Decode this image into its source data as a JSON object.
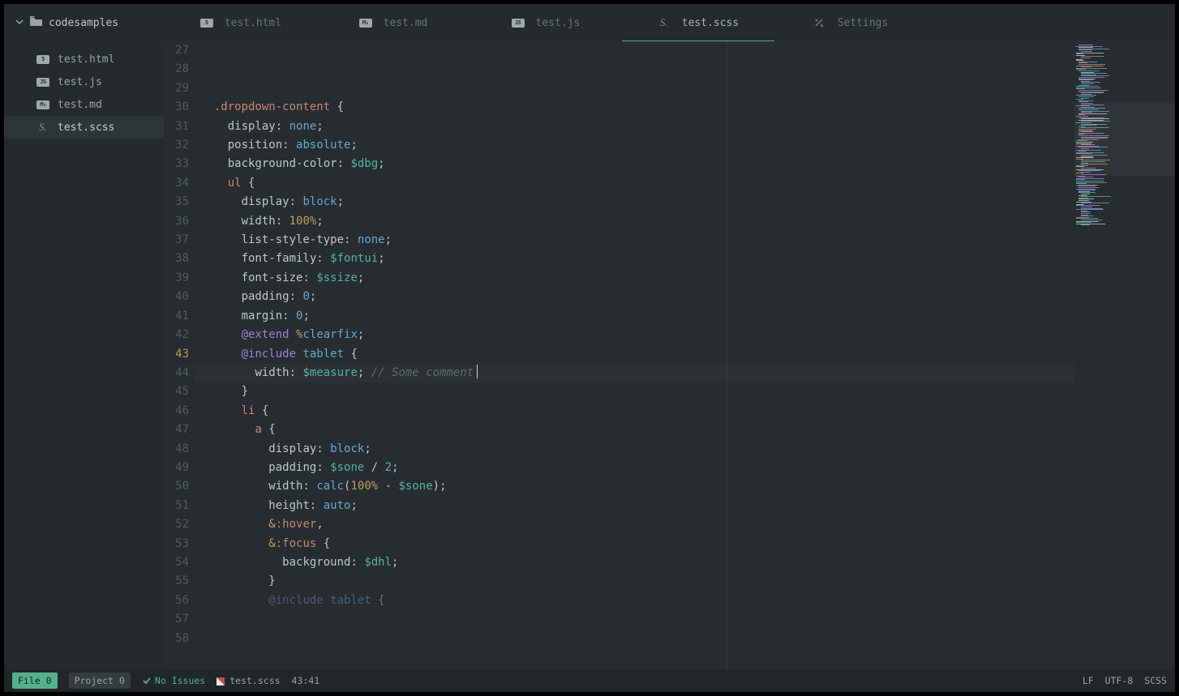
{
  "project": {
    "name": "codesamples"
  },
  "sidebar": {
    "files": [
      {
        "name": "test.html",
        "type": "html"
      },
      {
        "name": "test.js",
        "type": "js"
      },
      {
        "name": "test.md",
        "type": "md"
      },
      {
        "name": "test.scss",
        "type": "scss",
        "active": true
      }
    ]
  },
  "tabs": [
    {
      "label": "test.html",
      "type": "html"
    },
    {
      "label": "test.md",
      "type": "md"
    },
    {
      "label": "test.js",
      "type": "js"
    },
    {
      "label": "test.scss",
      "type": "scss",
      "active": true
    },
    {
      "label": "Settings",
      "type": "settings"
    }
  ],
  "editor": {
    "first_line_no": 27,
    "current_line_no": 43,
    "lines": [
      {
        "n": 27,
        "i": 2,
        "t": [
          [
            ".dropdown-content",
            "sel"
          ],
          [
            " {",
            "punc"
          ]
        ]
      },
      {
        "n": 28,
        "i": 4,
        "t": [
          [
            "display",
            "prop"
          ],
          [
            ":",
            "punc"
          ],
          [
            " ",
            ""
          ],
          [
            "none",
            "val"
          ],
          [
            ";",
            "punc"
          ]
        ]
      },
      {
        "n": 29,
        "i": 4,
        "t": [
          [
            "position",
            "prop"
          ],
          [
            ":",
            "punc"
          ],
          [
            " ",
            ""
          ],
          [
            "absolute",
            "val"
          ],
          [
            ";",
            "punc"
          ]
        ]
      },
      {
        "n": 30,
        "i": 4,
        "t": [
          [
            "background-color",
            "prop"
          ],
          [
            ":",
            "punc"
          ],
          [
            " ",
            ""
          ],
          [
            "$dbg",
            "var"
          ],
          [
            ";",
            "punc"
          ]
        ]
      },
      {
        "n": 31,
        "i": 0,
        "t": []
      },
      {
        "n": 32,
        "i": 4,
        "t": [
          [
            "ul",
            "sel"
          ],
          [
            " {",
            "punc"
          ]
        ]
      },
      {
        "n": 33,
        "i": 6,
        "t": [
          [
            "display",
            "prop"
          ],
          [
            ":",
            "punc"
          ],
          [
            " ",
            ""
          ],
          [
            "block",
            "val"
          ],
          [
            ";",
            "punc"
          ]
        ]
      },
      {
        "n": 34,
        "i": 6,
        "t": [
          [
            "width",
            "prop"
          ],
          [
            ":",
            "punc"
          ],
          [
            " ",
            ""
          ],
          [
            "100%",
            "num"
          ],
          [
            ";",
            "punc"
          ]
        ]
      },
      {
        "n": 35,
        "i": 6,
        "t": [
          [
            "list-style-type",
            "prop"
          ],
          [
            ":",
            "punc"
          ],
          [
            " ",
            ""
          ],
          [
            "none",
            "val"
          ],
          [
            ";",
            "punc"
          ]
        ]
      },
      {
        "n": 36,
        "i": 6,
        "t": [
          [
            "font-family",
            "prop"
          ],
          [
            ":",
            "punc"
          ],
          [
            " ",
            ""
          ],
          [
            "$fontui",
            "var"
          ],
          [
            ";",
            "punc"
          ]
        ]
      },
      {
        "n": 37,
        "i": 6,
        "t": [
          [
            "font-size",
            "prop"
          ],
          [
            ":",
            "punc"
          ],
          [
            " ",
            ""
          ],
          [
            "$ssize",
            "var"
          ],
          [
            ";",
            "punc"
          ]
        ]
      },
      {
        "n": 38,
        "i": 6,
        "t": [
          [
            "padding",
            "prop"
          ],
          [
            ":",
            "punc"
          ],
          [
            " ",
            ""
          ],
          [
            "0",
            "val"
          ],
          [
            ";",
            "punc"
          ]
        ]
      },
      {
        "n": 39,
        "i": 6,
        "t": [
          [
            "margin",
            "prop"
          ],
          [
            ":",
            "punc"
          ],
          [
            " ",
            ""
          ],
          [
            "0",
            "val"
          ],
          [
            ";",
            "punc"
          ]
        ]
      },
      {
        "n": 40,
        "i": 6,
        "t": [
          [
            "@extend",
            "at"
          ],
          [
            " ",
            ""
          ],
          [
            "%",
            "pct"
          ],
          [
            "clearfix",
            "mix"
          ],
          [
            ";",
            "punc"
          ]
        ]
      },
      {
        "n": 41,
        "i": 0,
        "t": []
      },
      {
        "n": 42,
        "i": 6,
        "t": [
          [
            "@include",
            "at"
          ],
          [
            " ",
            ""
          ],
          [
            "tablet",
            "mix"
          ],
          [
            " {",
            "punc"
          ]
        ]
      },
      {
        "n": 43,
        "i": 8,
        "t": [
          [
            "width",
            "prop"
          ],
          [
            ":",
            "punc"
          ],
          [
            " ",
            ""
          ],
          [
            "$measure",
            "var"
          ],
          [
            ";",
            "punc"
          ],
          [
            " ",
            ""
          ],
          [
            "// Some comment",
            "cmt"
          ]
        ],
        "cur": true
      },
      {
        "n": 44,
        "i": 6,
        "t": [
          [
            "}",
            "punc"
          ]
        ]
      },
      {
        "n": 45,
        "i": 0,
        "t": []
      },
      {
        "n": 46,
        "i": 6,
        "t": [
          [
            "li",
            "sel"
          ],
          [
            " {",
            "punc"
          ]
        ]
      },
      {
        "n": 47,
        "i": 8,
        "t": [
          [
            "a",
            "sel"
          ],
          [
            " {",
            "punc"
          ]
        ]
      },
      {
        "n": 48,
        "i": 10,
        "t": [
          [
            "display",
            "prop"
          ],
          [
            ":",
            "punc"
          ],
          [
            " ",
            ""
          ],
          [
            "block",
            "val"
          ],
          [
            ";",
            "punc"
          ]
        ]
      },
      {
        "n": 49,
        "i": 10,
        "t": [
          [
            "padding",
            "prop"
          ],
          [
            ":",
            "punc"
          ],
          [
            " ",
            ""
          ],
          [
            "$sone",
            "var"
          ],
          [
            " / ",
            "op"
          ],
          [
            "2",
            "val"
          ],
          [
            ";",
            "punc"
          ]
        ]
      },
      {
        "n": 50,
        "i": 10,
        "t": [
          [
            "width",
            "prop"
          ],
          [
            ":",
            "punc"
          ],
          [
            " ",
            ""
          ],
          [
            "calc",
            "calc"
          ],
          [
            "(",
            "punc"
          ],
          [
            "100%",
            "num"
          ],
          [
            " - ",
            "op"
          ],
          [
            "$sone",
            "var"
          ],
          [
            ")",
            "punc"
          ],
          [
            ";",
            "punc"
          ]
        ]
      },
      {
        "n": 51,
        "i": 10,
        "t": [
          [
            "height",
            "prop"
          ],
          [
            ":",
            "punc"
          ],
          [
            " ",
            ""
          ],
          [
            "auto",
            "val"
          ],
          [
            ";",
            "punc"
          ]
        ]
      },
      {
        "n": 52,
        "i": 0,
        "t": []
      },
      {
        "n": 53,
        "i": 10,
        "t": [
          [
            "&",
            "amp"
          ],
          [
            ":",
            "punc-dim"
          ],
          [
            "hover",
            "psd"
          ],
          [
            ",",
            "punc"
          ]
        ]
      },
      {
        "n": 54,
        "i": 10,
        "t": [
          [
            "&",
            "amp"
          ],
          [
            ":",
            "punc-dim"
          ],
          [
            "focus",
            "psd"
          ],
          [
            " {",
            "punc"
          ]
        ]
      },
      {
        "n": 55,
        "i": 12,
        "t": [
          [
            "background",
            "prop"
          ],
          [
            ":",
            "punc"
          ],
          [
            " ",
            ""
          ],
          [
            "$dhl",
            "var"
          ],
          [
            ";",
            "punc"
          ]
        ]
      },
      {
        "n": 56,
        "i": 10,
        "t": [
          [
            "}",
            "punc"
          ]
        ]
      },
      {
        "n": 57,
        "i": 0,
        "t": []
      },
      {
        "n": 58,
        "i": 10,
        "t": [
          [
            "@include",
            "at"
          ],
          [
            " ",
            ""
          ],
          [
            "tablet",
            "mix"
          ],
          [
            " {",
            "punc"
          ]
        ],
        "clip": true
      }
    ]
  },
  "status": {
    "file_badge": "File",
    "file_count": "0",
    "project_badge": "Project",
    "project_count": "0",
    "issues": "No Issues",
    "filename": "test.scss",
    "cursor": "43:41",
    "eol": "LF",
    "encoding": "UTF-8",
    "lang": "SCSS"
  }
}
